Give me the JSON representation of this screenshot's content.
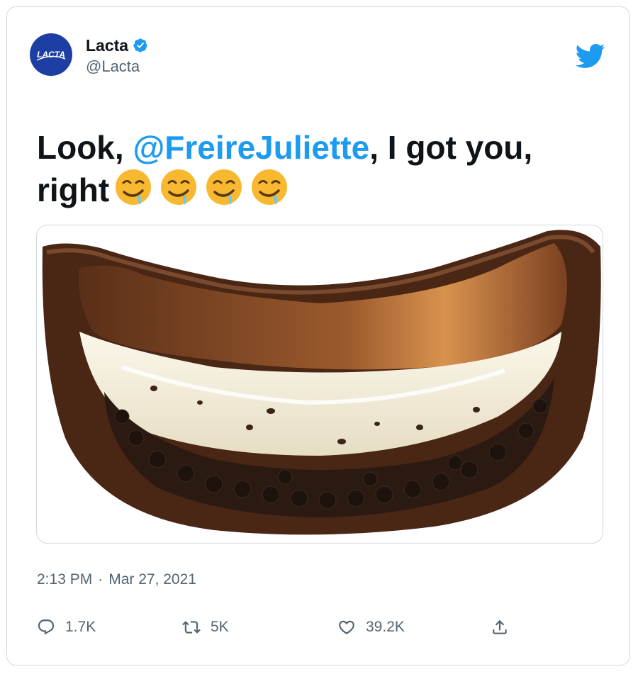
{
  "author": {
    "name": "Lacta",
    "handle": "@Lacta",
    "avatar_text": "LACTA",
    "verified": true,
    "brand_color": "#1d3fa3"
  },
  "tweet": {
    "text_before": "Look, ",
    "mention": "@FreireJuliette",
    "text_after": ", I got you, right",
    "emojis": [
      "drooling-face",
      "drooling-face",
      "drooling-face",
      "drooling-face"
    ]
  },
  "meta": {
    "time": "2:13 PM",
    "separator": "·",
    "date": "Mar 27, 2021"
  },
  "actions": {
    "replies": "1.7K",
    "retweets": "5K",
    "likes": "39.2K"
  },
  "colors": {
    "accent": "#1d9bf0",
    "text": "#0f1419",
    "secondary": "#536471",
    "border": "#cfd9de"
  },
  "icons": {
    "reply": "reply-icon",
    "retweet": "retweet-icon",
    "like": "heart-icon",
    "share": "share-icon",
    "logo": "twitter-bird-icon"
  }
}
